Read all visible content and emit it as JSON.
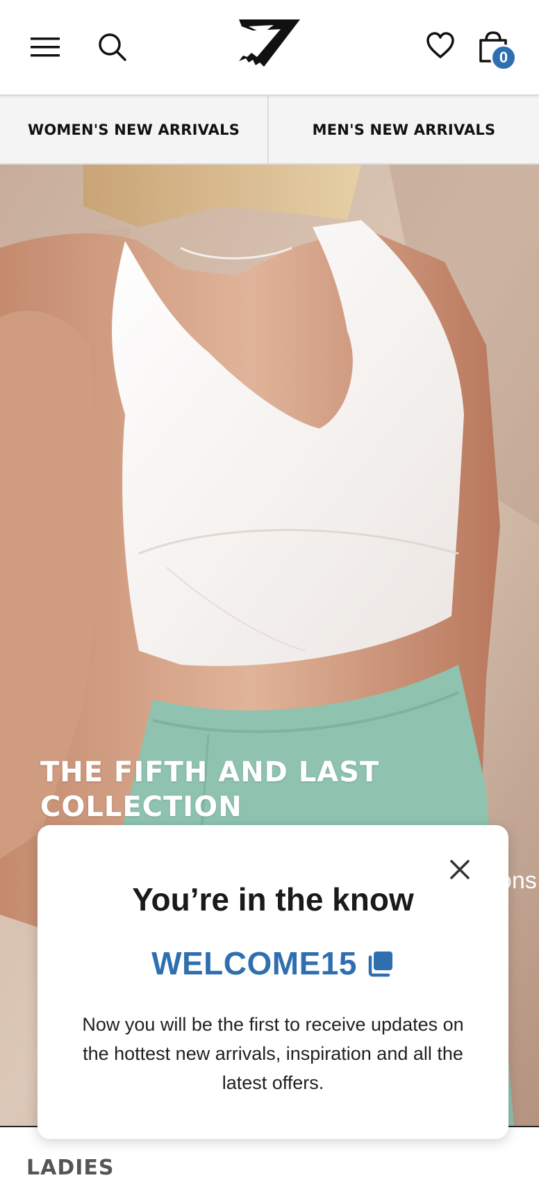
{
  "header": {
    "menu_icon": "hamburger-menu-icon",
    "search_icon": "search-icon",
    "logo_icon": "gymshark-logo",
    "wishlist_icon": "heart-icon",
    "bag_icon": "shopping-bag-icon",
    "cart_count": "0",
    "accent_color": "#2f6fb0"
  },
  "tabs": [
    {
      "label": "WOMEN'S NEW ARRIVALS"
    },
    {
      "label": "MEN'S NEW ARRIVALS"
    }
  ],
  "hero": {
    "title": "THE FIFTH AND LAST COLLECTION",
    "peek_text": "ons"
  },
  "modal": {
    "title": "You’re in the know",
    "promo_code": "WELCOME15",
    "copy_icon": "copy-icon",
    "close_icon": "close-icon",
    "body": "Now you will be the first to receive updates on the hottest new arrivals, inspiration and all the latest offers."
  },
  "section": {
    "label": "LADIES"
  }
}
